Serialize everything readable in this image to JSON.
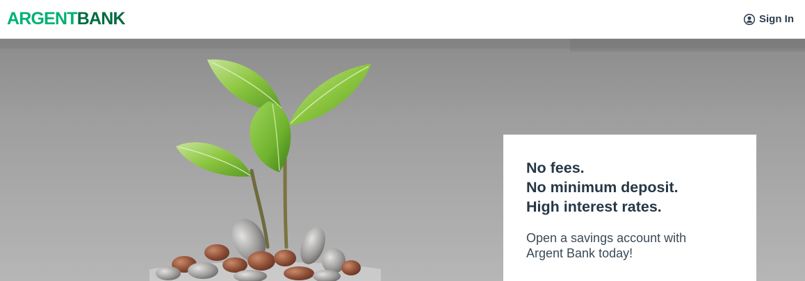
{
  "header": {
    "brand_part1": "ARGENT",
    "brand_part2": "BANK",
    "signin_label": "Sign In",
    "signin_icon": "user-circle-icon"
  },
  "hero": {
    "image_subject": "plant-sprouting-from-coins-photo",
    "headline_lines": [
      "No fees.",
      "No minimum deposit.",
      "High interest rates."
    ],
    "subtext": "Open a savings account with Argent Bank today!"
  },
  "colors": {
    "brand_light_green": "#00b173",
    "brand_dark_green": "#006b3f",
    "text_dark": "#253746"
  }
}
